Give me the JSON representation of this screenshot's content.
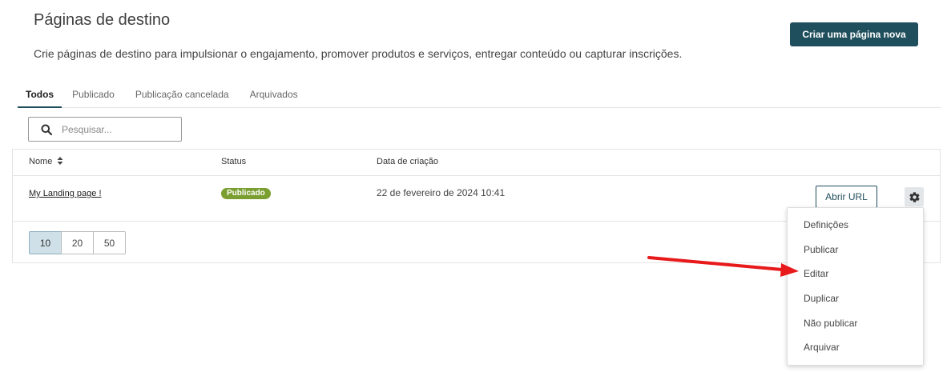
{
  "header": {
    "title": "Páginas de destino",
    "description": "Crie páginas de destino para impulsionar o engajamento, promover produtos e serviços, entregar conteúdo ou capturar inscrições.",
    "create_label": "Criar uma página nova"
  },
  "tabs": [
    {
      "label": "Todos"
    },
    {
      "label": "Publicado"
    },
    {
      "label": "Publicação cancelada"
    },
    {
      "label": "Arquivados"
    }
  ],
  "search": {
    "placeholder": "Pesquisar..."
  },
  "table": {
    "columns": {
      "name": "Nome",
      "status": "Status",
      "created": "Data de criação"
    },
    "rows": [
      {
        "name": "My Landing page !",
        "status": "Publicado",
        "created": "22 de fevereiro de 2024 10:41",
        "open_url_label": "Abrir URL"
      }
    ]
  },
  "pagination": {
    "sizes": [
      "10",
      "20",
      "50"
    ],
    "selected": "10"
  },
  "menu": {
    "items": [
      "Definições",
      "Publicar",
      "Editar",
      "Duplicar",
      "Não publicar",
      "Arquivar"
    ]
  },
  "colors": {
    "primary": "#1f4e5c",
    "badge": "#7a9e2f",
    "arrow": "#e8191b"
  }
}
